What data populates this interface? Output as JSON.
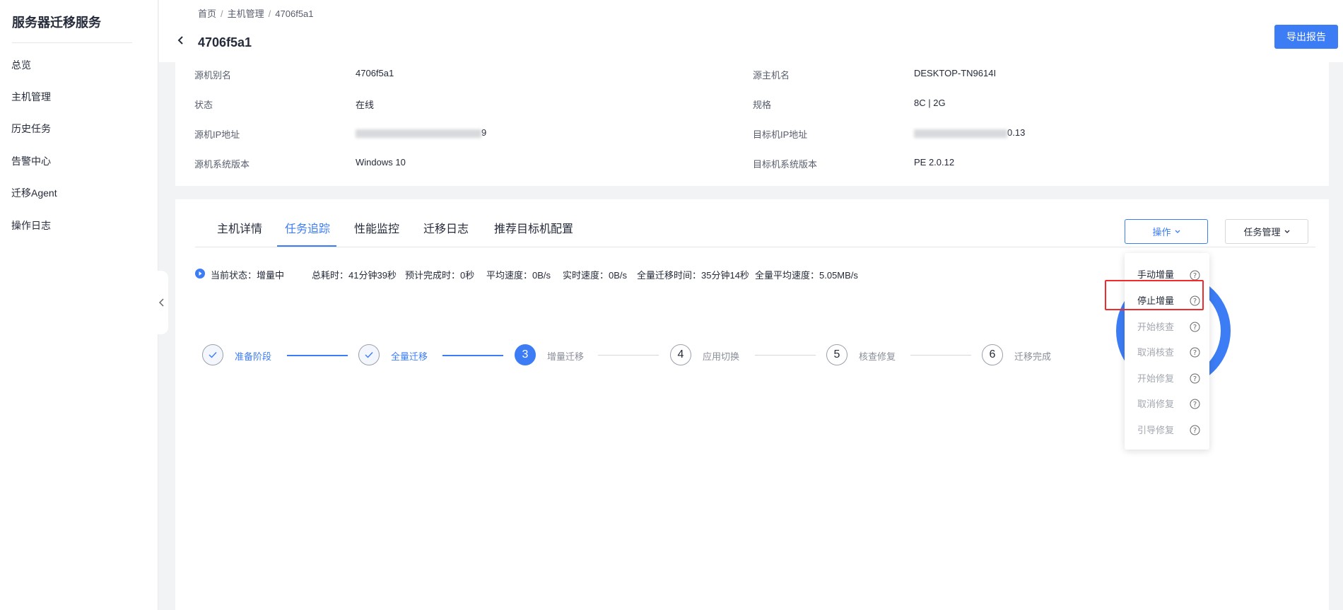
{
  "sidebar": {
    "title": "服务器迁移服务",
    "items": [
      {
        "label": "总览"
      },
      {
        "label": "主机管理"
      },
      {
        "label": "历史任务"
      },
      {
        "label": "告警中心"
      },
      {
        "label": "迁移Agent"
      },
      {
        "label": "操作日志"
      }
    ]
  },
  "breadcrumb": [
    "首页",
    "主机管理",
    "4706f5a1"
  ],
  "breadcrumb_separator": "/",
  "header": {
    "title": "4706f5a1",
    "export_label": "导出报告"
  },
  "info": {
    "source_alias_label": "源机别名",
    "source_alias_value": "4706f5a1",
    "source_host_label": "源主机名",
    "source_host_value": "DESKTOP-TN9614I",
    "status_label": "状态",
    "status_value": "在线",
    "spec_label": "规格",
    "spec_value": "8C | 2G",
    "source_ip_label": "源机IP地址",
    "source_ip_tail": "9",
    "target_ip_label": "目标机IP地址",
    "target_ip_tail": "0.13",
    "source_os_label": "源机系统版本",
    "source_os_value": "Windows 10",
    "target_os_label": "目标机系统版本",
    "target_os_value": "PE 2.0.12"
  },
  "tabs": [
    {
      "label": "主机详情"
    },
    {
      "label": "任务追踪"
    },
    {
      "label": "性能监控"
    },
    {
      "label": "迁移日志"
    },
    {
      "label": "推荐目标机配置"
    }
  ],
  "active_tab": "任务追踪",
  "actions": {
    "operate_label": "操作",
    "task_manage_label": "任务管理"
  },
  "status": {
    "current": "当前状态：增量中",
    "total_time": "总耗时：41分钟39秒",
    "eta": "预计完成时：0秒",
    "avg_speed": "平均速度：0B/s",
    "realtime_speed": "实时速度：0B/s",
    "full_time": "全量迁移时间：35分钟14秒",
    "full_avg_speed": "全量平均速度：5.05MB/s"
  },
  "steps": [
    {
      "num": "1",
      "label": "准备阶段",
      "state": "done"
    },
    {
      "num": "2",
      "label": "全量迁移",
      "state": "done"
    },
    {
      "num": "3",
      "label": "增量迁移",
      "state": "current"
    },
    {
      "num": "4",
      "label": "应用切换",
      "state": "pending"
    },
    {
      "num": "5",
      "label": "核查修复",
      "state": "pending"
    },
    {
      "num": "6",
      "label": "迁移完成",
      "state": "pending"
    }
  ],
  "dropdown": [
    {
      "label": "手动增量",
      "enabled": true
    },
    {
      "label": "停止增量",
      "enabled": true
    },
    {
      "label": "开始核查",
      "enabled": false
    },
    {
      "label": "取消核查",
      "enabled": false
    },
    {
      "label": "开始修复",
      "enabled": false
    },
    {
      "label": "取消修复",
      "enabled": false
    },
    {
      "label": "引导修复",
      "enabled": false
    }
  ],
  "colors": {
    "accent": "#3c7cf5",
    "highlight": "#f02b2b"
  }
}
